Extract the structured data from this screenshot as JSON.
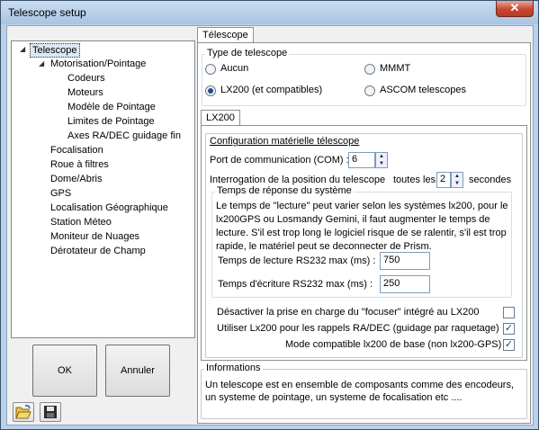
{
  "window": {
    "title": "Telescope setup",
    "close_glyph": "✕"
  },
  "tree": {
    "items": [
      "Telescope",
      "Motorisation/Pointage",
      "Codeurs",
      "Moteurs",
      "Modèle de Pointage",
      "Limites de Pointage",
      "Axes RA/DEC guidage fin",
      "Focalisation",
      "Roue à filtres",
      "Dome/Abris",
      "GPS",
      "Localisation Géographique",
      "Station Méteo",
      "Moniteur de Nuages",
      "Dérotateur de Champ"
    ]
  },
  "buttons": {
    "ok": "OK",
    "cancel": "Annuler",
    "open_icon": "folder-open-icon",
    "save_icon": "save-icon"
  },
  "main_tab": "Télescope",
  "type_group": {
    "title": "Type de telescope",
    "options": [
      "Aucun",
      "LX200 (et compatibles)",
      "MMMT",
      "ASCOM telescopes"
    ],
    "selected": "LX200 (et compatibles)"
  },
  "sub_tab": "LX200",
  "config": {
    "heading": "Configuration matérielle télescope",
    "port_label": "Port de communication (COM) :",
    "port_value": "6",
    "poll_label": "Interrogation de la position du telescope",
    "poll_every": "toutes les :",
    "poll_value": "2",
    "poll_unit": "secondes",
    "response": {
      "title": "Temps de réponse du système",
      "text": "Le temps de \"lecture\" peut varier selon les systèmes lx200, pour le lx200GPS ou Losmandy Gemini, il faut augmenter le temps de lecture. S'il est trop long le logiciel risque de se ralentir, s'il est trop rapide, le matériel peut se deconnecter de Prism.",
      "read_label": "Temps de lecture RS232 max (ms) :",
      "read_value": "750",
      "write_label": "Temps d'écriture RS232 max (ms) :",
      "write_value": "250"
    },
    "checks": [
      {
        "label": "Désactiver la prise en charge du \"focuser\" intégré au LX200",
        "checked": false
      },
      {
        "label": "Utiliser Lx200 pour les rappels RA/DEC (guidage par raquetage)",
        "checked": true
      },
      {
        "label": "Mode compatible lx200 de base (non lx200-GPS)",
        "checked": true
      }
    ]
  },
  "info": {
    "title": "Informations",
    "text": "Un telescope est en ensemble de composants comme des encodeurs, un systeme de pointage, un systeme de focalisation etc ...."
  }
}
